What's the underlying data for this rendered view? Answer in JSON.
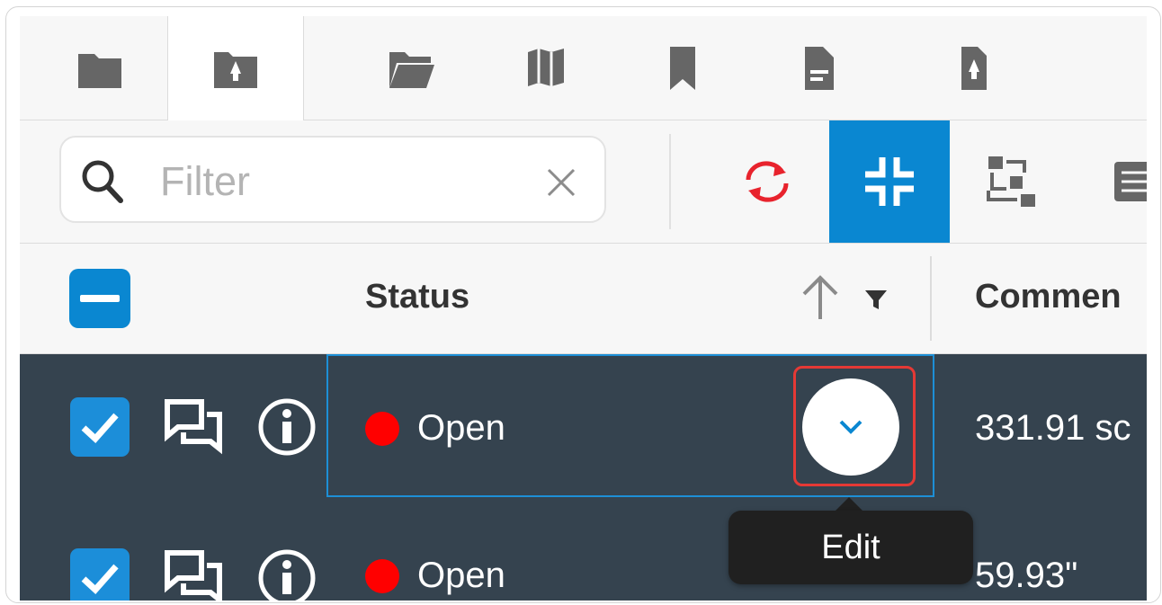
{
  "tabs": [
    {
      "icon": "folder-icon",
      "active": false
    },
    {
      "icon": "drawing-folder-icon",
      "active": true
    },
    {
      "icon": "folder-open-icon",
      "active": false
    },
    {
      "icon": "map-icon",
      "active": false
    },
    {
      "icon": "bookmark-icon",
      "active": false
    },
    {
      "icon": "document-icon",
      "active": false
    },
    {
      "icon": "drawing-icon",
      "active": false
    }
  ],
  "toolbar": {
    "filter_placeholder": "Filter",
    "buttons": [
      {
        "icon": "sync-icon",
        "active": false,
        "color": "#e8232d"
      },
      {
        "icon": "collapse-icon",
        "active": true,
        "color": "#ffffff"
      },
      {
        "icon": "workflow-icon",
        "active": false,
        "color": "#666666"
      },
      {
        "icon": "list-icon",
        "active": false,
        "color": "#666666"
      }
    ]
  },
  "header": {
    "status_label": "Status",
    "comments_label": "Commen"
  },
  "rows": [
    {
      "status": "Open",
      "value": "331.91 sc",
      "checked": true
    },
    {
      "status": "Open",
      "value": "59.93\"",
      "checked": true
    }
  ],
  "tooltip": {
    "text": "Edit"
  },
  "colors": {
    "accent": "#0a87d1",
    "row_bg": "#35434f",
    "status_open": "#ff0000",
    "highlight": "#e53935",
    "icon_gray": "#666666"
  }
}
